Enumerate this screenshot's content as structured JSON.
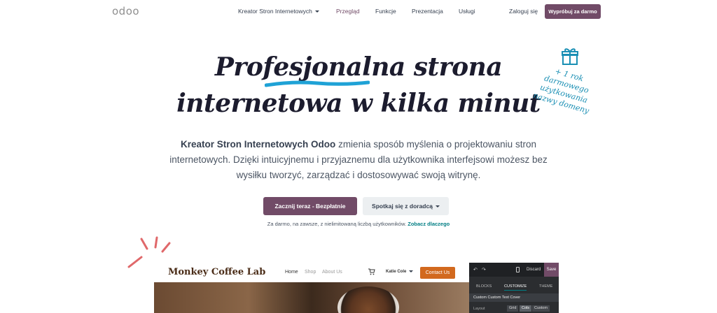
{
  "nav": {
    "logo": "odoo",
    "items": [
      {
        "label": "Kreator Stron Internetowych",
        "dropdown": true
      },
      {
        "label": "Przegląd",
        "active": true
      },
      {
        "label": "Funkcje"
      },
      {
        "label": "Prezentacja"
      },
      {
        "label": "Usługi"
      }
    ],
    "login": "Zaloguj się",
    "try_button": "Wypróbuj za darmo"
  },
  "hero": {
    "headline_line1": "Profesjonalna strona",
    "headline_line2": "internetowa w kilka minut",
    "promo_lines": [
      "+ 1 rok",
      "darmowego",
      "użytkowania",
      "nazwy domeny"
    ],
    "lead_bold": "Kreator Stron Internetowych Odoo",
    "lead_rest": " zmienia sposób myślenia o projektowaniu stron internetowych. Dzięki intuicyjnemu i przyjaznemu dla użytkownika interfejsowi możesz bez wysiłku tworzyć, zarządzać i dostosowywać swoją witrynę.",
    "primary_button": "Zacznij teraz - Bezpłatnie",
    "secondary_button": "Spotkaj się z doradcą",
    "free_note": "Za darmo, na zawsze, z nielimitowaną liczbą użytkowników.",
    "free_note_link": "Zobacz dlaczego"
  },
  "preview": {
    "site": {
      "logo_word1": "Monkey",
      "logo_word2": "Coffee",
      "logo_word3": "Lab",
      "nav": [
        "Home",
        "Shop",
        "About Us"
      ],
      "user": "Katie Cole",
      "contact_button": "Contact Us"
    },
    "editor": {
      "discard": "Discard",
      "save": "Save",
      "tabs": [
        "BLOCKS",
        "CUSTOMIZE",
        "THEME"
      ],
      "active_tab": "CUSTOMIZE",
      "section_label": "Custom Custom Text Cover",
      "row_label": "Layout",
      "row_options": [
        "Grid",
        "Cols",
        "Custom"
      ]
    }
  },
  "colors": {
    "brand": "#714B67",
    "accent_link": "#017e84",
    "promo": "#1a8fb4",
    "underline": "#1fa2d6",
    "sparks": "#e0686a"
  }
}
